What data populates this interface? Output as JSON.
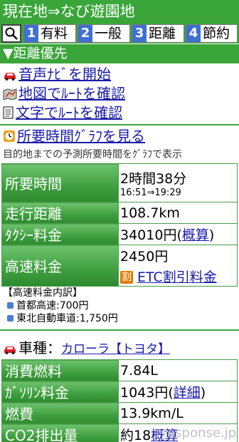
{
  "title": "現在地⇒なび遊園地",
  "tabs": [
    {
      "num": "1",
      "label": "有料"
    },
    {
      "num": "2",
      "label": "一般"
    },
    {
      "num": "3",
      "label": "距離"
    },
    {
      "num": "4",
      "label": "節約"
    }
  ],
  "section": {
    "title": "▼距離優先"
  },
  "links": {
    "voice_nav": "音声ﾅﾋﾞを開始",
    "map_route": "地図でﾙｰﾄを確認",
    "text_route": "文字でﾙｰﾄを確認",
    "time_graph": "所要時間ｸﾞﾗﾌを見る"
  },
  "note": "目的地までの予測所要時間をｸﾞﾗﾌで表示",
  "summary": {
    "time_label": "所要時間",
    "time_value": "2時間38分",
    "time_range": "16:51⇒19:29",
    "distance_label": "走行距離",
    "distance_value": "108.7km",
    "taxi_label": "ﾀｸｼｰ料金",
    "taxi_value": "34010円",
    "taxi_paren_open": "(",
    "taxi_link": "概算",
    "taxi_paren_close": ")",
    "toll_label": "高速料金",
    "toll_value": "2450円",
    "etc_badge": "割",
    "etc_link": "ETC割引料金"
  },
  "breakdown": {
    "title": "【高速料金内訳】",
    "items": [
      "首都高速:700円",
      "東北自動車道:1,750円"
    ]
  },
  "car": {
    "label": "車種：",
    "model": "カローラ【トヨタ】"
  },
  "fuel": {
    "consumption_label": "消費燃料",
    "consumption_value": "7.84L",
    "gas_label": "ｶﾞｿﾘﾝ料金",
    "gas_value": "1043円",
    "gas_paren_open": "(",
    "gas_link": "詳細",
    "gas_paren_close": ")",
    "efficiency_label": "燃費",
    "efficiency_value": "13.9km/L",
    "co2_label": "CO2排出量",
    "co2_value": "約18",
    "co2_link": "概算"
  },
  "watermark": "response.jp",
  "colors": {
    "green": "#3aa63a",
    "link": "#1a1aa8",
    "tab_num": "#3f6fd1"
  }
}
